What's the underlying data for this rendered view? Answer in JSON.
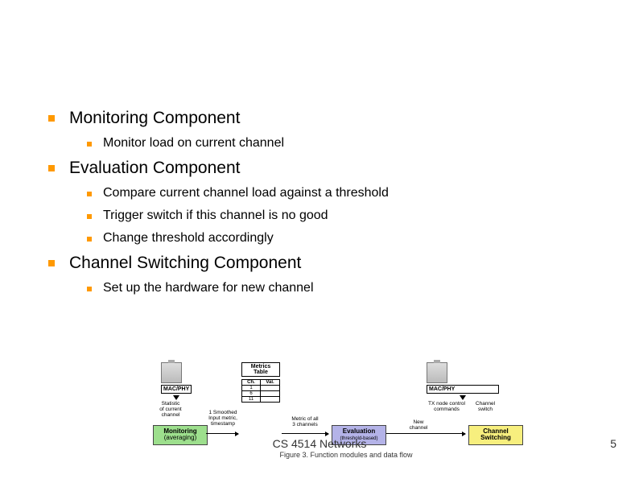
{
  "bullets": [
    {
      "text": "Monitoring Component",
      "sub": [
        "Monitor load on current channel"
      ]
    },
    {
      "text": "Evaluation Component",
      "sub": [
        "Compare current channel load against a threshold",
        "Trigger switch if this channel is no good",
        "Change threshold accordingly"
      ]
    },
    {
      "text": "Channel Switching Component",
      "sub": [
        "Set up the hardware for new channel"
      ]
    }
  ],
  "diagram": {
    "macphy": "MAC/PHY",
    "hostA_label": "Statistic\nof current\nchannel",
    "hostB_label": "TX node control\ncommands",
    "metrics": {
      "title": "Metrics\nTable",
      "cols": [
        "Ch.",
        "Val."
      ],
      "rows": [
        [
          "1",
          ""
        ],
        [
          "6",
          ""
        ],
        [
          "11",
          ""
        ]
      ]
    },
    "arrow_mon_metrics": "1 Smoothed\nInput metric,\ntimestamp",
    "arrow_metrics_eval": "Metric of all\n3 channels",
    "arrow_eval_switch": "New\nchannel",
    "arrow_switch_host": "Channel\nswitch",
    "modules": {
      "monitoring": {
        "title": "Monitoring",
        "sub": "(averaging)"
      },
      "evaluation": {
        "title": "Evaluation",
        "sub": "(threshold-based)"
      },
      "switching": {
        "title": "Channel\nSwitching",
        "sub": ""
      }
    },
    "caption": "Figure 3. Function modules and data flow"
  },
  "footer": {
    "center": "CS 4514 Networks",
    "pageno": "5"
  }
}
